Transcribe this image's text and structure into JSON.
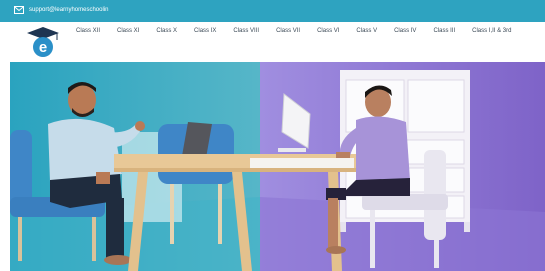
{
  "topbar": {
    "email": "support@learnyhomeschoolin",
    "mail_icon": "mail-icon"
  },
  "logo": {
    "icon": "graduation-cap-logo",
    "letter": "e"
  },
  "menu": {
    "items": [
      {
        "label": "Class XII"
      },
      {
        "label": "Class XI"
      },
      {
        "label": "Class X"
      },
      {
        "label": "Class IX"
      },
      {
        "label": "Class VIII"
      },
      {
        "label": "Class VII"
      },
      {
        "label": "Class VI"
      },
      {
        "label": "Class V"
      },
      {
        "label": "Class IV"
      },
      {
        "label": "Class III"
      },
      {
        "label": "Class I,II & 3rd"
      }
    ]
  },
  "hero": {
    "colors": {
      "left_bg": "#2fa9c2",
      "right_bg": "#8a6fd0",
      "desk": "#e9c89b",
      "chair_blue": "#3f86c7",
      "chair_white": "#e9e7f0"
    }
  }
}
